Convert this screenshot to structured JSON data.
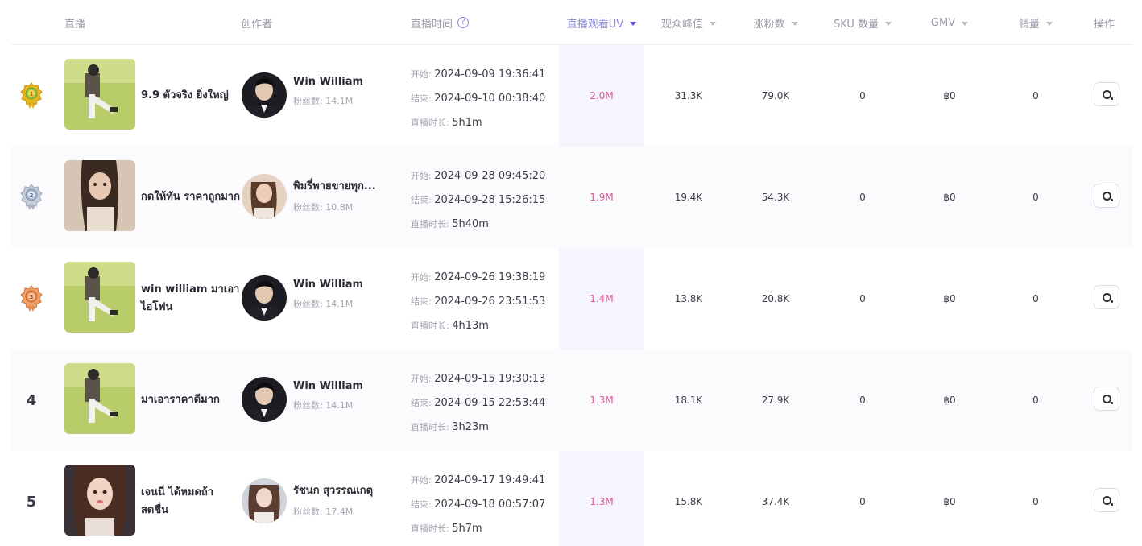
{
  "headers": {
    "live": "直播",
    "creator": "创作者",
    "live_time": "直播时间",
    "uv": "直播观看UV",
    "peak": "观众峰值",
    "fans_gain": "涨粉数",
    "sku": "SKU 数量",
    "gmv": "GMV",
    "sales": "销量",
    "action": "操作"
  },
  "labels": {
    "start": "开始: ",
    "end": "结束: ",
    "duration": "直播时长: "
  },
  "rows": [
    {
      "rank": "1",
      "title": "9.9 ตัวจริง ยิ่งใหญ่",
      "creator": "Win William",
      "fans": "粉丝数: 14.1M",
      "start": "2024-09-09 19:36:41",
      "end": "2024-09-10 00:38:40",
      "duration": "5h1m",
      "uv": "2.0M",
      "peak": "31.3K",
      "fans_gain": "79.0K",
      "sku": "0",
      "gmv": "฿0",
      "sales": "0"
    },
    {
      "rank": "2",
      "title": "กดให้ทัน ราคาถูกมาก",
      "creator": "พิมรี่พายขายทุก...",
      "fans": "粉丝数: 10.8M",
      "start": "2024-09-28 09:45:20",
      "end": "2024-09-28 15:26:15",
      "duration": "5h40m",
      "uv": "1.9M",
      "peak": "19.4K",
      "fans_gain": "54.3K",
      "sku": "0",
      "gmv": "฿0",
      "sales": "0"
    },
    {
      "rank": "3",
      "title": "win william มาเอาไอโฟน",
      "creator": "Win William",
      "fans": "粉丝数: 14.1M",
      "start": "2024-09-26 19:38:19",
      "end": "2024-09-26 23:51:53",
      "duration": "4h13m",
      "uv": "1.4M",
      "peak": "13.8K",
      "fans_gain": "20.8K",
      "sku": "0",
      "gmv": "฿0",
      "sales": "0"
    },
    {
      "rank": "4",
      "title": "มาเอาราคาดีมาก",
      "creator": "Win William",
      "fans": "粉丝数: 14.1M",
      "start": "2024-09-15 19:30:13",
      "end": "2024-09-15 22:53:44",
      "duration": "3h23m",
      "uv": "1.3M",
      "peak": "18.1K",
      "fans_gain": "27.9K",
      "sku": "0",
      "gmv": "฿0",
      "sales": "0"
    },
    {
      "rank": "5",
      "title": "เจนนี่ ได้หมดถ้าสดชื่น",
      "creator": "รัชนก สุวรรณเกตุ",
      "fans": "粉丝数: 17.4M",
      "start": "2024-09-17 19:49:41",
      "end": "2024-09-18 00:57:07",
      "duration": "5h7m",
      "uv": "1.3M",
      "peak": "15.8K",
      "fans_gain": "37.4K",
      "sku": "0",
      "gmv": "฿0",
      "sales": "0"
    }
  ],
  "colors": {
    "uv_value": "#e0559a",
    "active_sort": "#5a4fe0",
    "gold": "#e8b51c",
    "silver": "#aab3c4",
    "bronze": "#e88a4e"
  },
  "icons": {
    "rank_1": "gold-medal-icon",
    "rank_2": "silver-medal-icon",
    "rank_3": "bronze-medal-icon",
    "help": "question-icon",
    "sort": "caret-down-icon",
    "action": "search-icon"
  }
}
